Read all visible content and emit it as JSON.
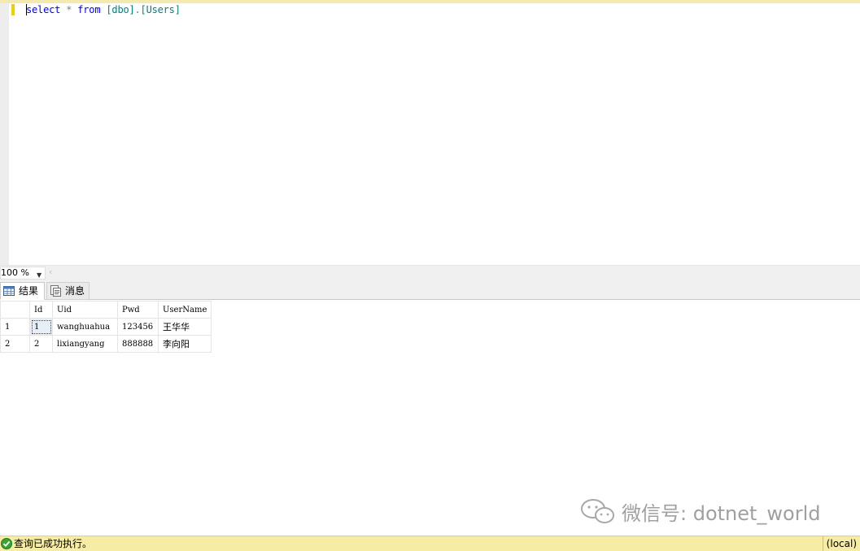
{
  "editor": {
    "tokens": {
      "kw_select": "select",
      "op_star": "*",
      "kw_from": "from",
      "schema": "[dbo]",
      "dot": ".",
      "table": "[Users]"
    }
  },
  "zoom": {
    "value": "100 %"
  },
  "tabs": [
    {
      "label": "结果",
      "icon": "grid-icon"
    },
    {
      "label": "消息",
      "icon": "document-icon"
    }
  ],
  "results": {
    "columns": [
      "",
      "Id",
      "Uid",
      "Pwd",
      "UserName"
    ],
    "rows": [
      [
        "1",
        "1",
        "wanghuahua",
        "123456",
        "王华华"
      ],
      [
        "2",
        "2",
        "lixiangyang",
        "888888",
        "李向阳"
      ]
    ]
  },
  "watermark": {
    "text": "微信号: dotnet_world"
  },
  "status": {
    "message": "查询已成功执行。",
    "server": "(local)"
  },
  "colors": {
    "keyword": "#0000ff",
    "operator": "#808080",
    "identifier": "#008080",
    "status_bar": "#f7eca3"
  }
}
